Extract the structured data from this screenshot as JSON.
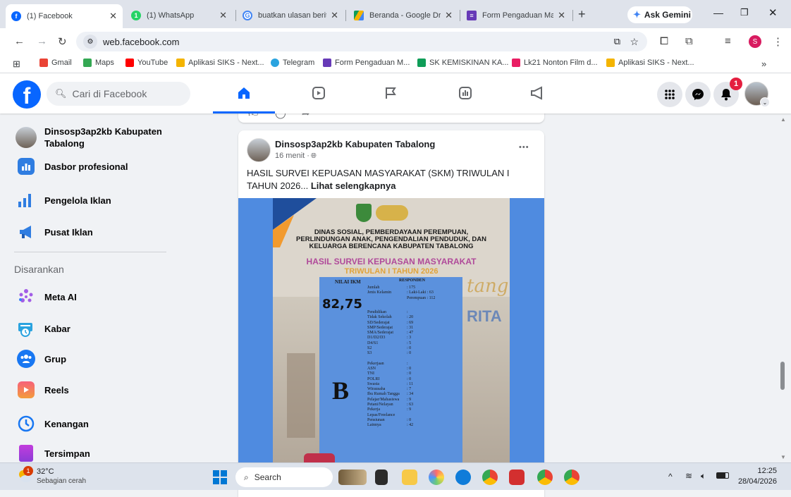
{
  "browser": {
    "tabs": [
      {
        "title": "(1) Facebook",
        "active": true,
        "icon": "facebook-icon"
      },
      {
        "title": "(1) WhatsApp",
        "active": false,
        "icon": "whatsapp-icon"
      },
      {
        "title": "buatkan ulasan berita",
        "active": false,
        "icon": "google-icon"
      },
      {
        "title": "Beranda - Google Drive",
        "active": false,
        "icon": "drive-icon"
      },
      {
        "title": "Form Pengaduan Ma",
        "active": false,
        "icon": "forms-icon"
      }
    ],
    "new_tab": "+",
    "ask_gemini": "Ask Gemini",
    "url": "web.facebook.com",
    "profile_initial": "S",
    "bookmarks": [
      {
        "label": "Gmail",
        "color": "#ea4335"
      },
      {
        "label": "Maps",
        "color": "#34a853"
      },
      {
        "label": "YouTube",
        "color": "#ff0000"
      },
      {
        "label": "Aplikasi SIKS - Next...",
        "color": "#f4b400"
      },
      {
        "label": "Telegram",
        "color": "#2aa3df"
      },
      {
        "label": "Form Pengaduan M...",
        "color": "#673ab7"
      },
      {
        "label": "SK KEMISKINAN KA...",
        "color": "#0f9d58"
      },
      {
        "label": "Lk21 Nonton Film d...",
        "color": "#e91e63"
      },
      {
        "label": "Aplikasi SIKS - Next...",
        "color": "#f4b400"
      }
    ],
    "more_bookmarks": "»"
  },
  "fb": {
    "logo": "f",
    "search_placeholder": "Cari di Facebook",
    "notification_count": "1",
    "accent": "#0866ff"
  },
  "sidebar": {
    "items": [
      {
        "label": "Dinsosp3ap2kb Kabupaten Tabalong",
        "icon": "page-avatar-icon"
      },
      {
        "label": "Dasbor profesional",
        "icon": "dashboard-icon"
      },
      {
        "label": "Pengelola Iklan",
        "icon": "ads-manager-icon"
      },
      {
        "label": "Pusat Iklan",
        "icon": "megaphone-icon"
      }
    ],
    "section_title": "Disarankan",
    "suggested": [
      {
        "label": "Meta AI",
        "icon": "meta-ai-icon"
      },
      {
        "label": "Kabar",
        "icon": "news-icon"
      },
      {
        "label": "Grup",
        "icon": "groups-icon"
      },
      {
        "label": "Reels",
        "icon": "reels-icon"
      },
      {
        "label": "Kenangan",
        "icon": "memories-icon"
      },
      {
        "label": "Tersimpan",
        "icon": "saved-icon"
      }
    ]
  },
  "post": {
    "author": "Dinsosp3ap2kb Kabupaten Tabalong",
    "time": "16 menit · ",
    "more": "•••",
    "text": "HASIL SURVEI KEPUASAN MASYARAKAT (SKM) TRIWULAN I TAHUN 2026...",
    "see_more": "Lihat selengkapnya",
    "image": {
      "org_line1": "DINAS SOSIAL, PEMBERDAYAAN PEREMPUAN,",
      "org_line2": "PERLINDUNGAN ANAK, PENGENDALIAN PENDUDUK, DAN",
      "org_line3": "KELUARGA BERENCANA KABUPATEN TABALONG",
      "survey_title": "HASIL SURVEI KEPUASAN MASYARAKAT",
      "survey_sub": "TRIWULAN I TAHUN 2026",
      "nilai_label": "NILAI IKM",
      "nilai_value": "82,75",
      "grade": "B",
      "responden_label": "RESPONDEN",
      "rows": [
        {
          "k": "Jumlah",
          "v": ": 175"
        },
        {
          "k": "Jenis Kelamin",
          "v": ": Laki-Laki   : 63"
        },
        {
          "k": "",
          "v": "Perempuan  : 112"
        },
        {
          "k": "Pendidikan",
          "v": ":"
        },
        {
          "k": "Tidak Sekolah",
          "v": ": 20"
        },
        {
          "k": "SD/Sederajat",
          "v": ": 69"
        },
        {
          "k": "SMP/Sederajat",
          "v": ": 31"
        },
        {
          "k": "SMA/Sederajat",
          "v": ": 47"
        },
        {
          "k": "D1/D2/D3",
          "v": ": 3"
        },
        {
          "k": "D4/S1",
          "v": ": 5"
        },
        {
          "k": "S2",
          "v": ": 0"
        },
        {
          "k": "S3",
          "v": ": 0"
        },
        {
          "k": "Pekerjaan",
          "v": ":"
        },
        {
          "k": "ASN",
          "v": ": 0"
        },
        {
          "k": "TNI",
          "v": ": 0"
        },
        {
          "k": "POLRI",
          "v": ": 0"
        },
        {
          "k": "Swasta",
          "v": ": 11"
        },
        {
          "k": "Wirausaha",
          "v": ": 7"
        },
        {
          "k": "Ibu Rumah Tangga",
          "v": ": 34"
        },
        {
          "k": "Pelajar/Mahasiswa",
          "v": ": 9"
        },
        {
          "k": "Petani/Nelayan",
          "v": ": 63"
        },
        {
          "k": "Pekerja",
          "v": ": 9"
        },
        {
          "k": "Lepas/Freelance",
          "v": ""
        },
        {
          "k": "Pensiunan",
          "v": ": 0"
        },
        {
          "k": "Lainnya",
          "v": ": 42"
        }
      ],
      "bg_text_1": "tang",
      "bg_text_2": "RITA"
    }
  },
  "taskbar": {
    "weather_temp": "32°C",
    "weather_desc": "Sebagian cerah",
    "weather_badge": "1",
    "search": "Search",
    "time": "12:25",
    "date": "28/04/2026",
    "tray_arrow": "^"
  }
}
